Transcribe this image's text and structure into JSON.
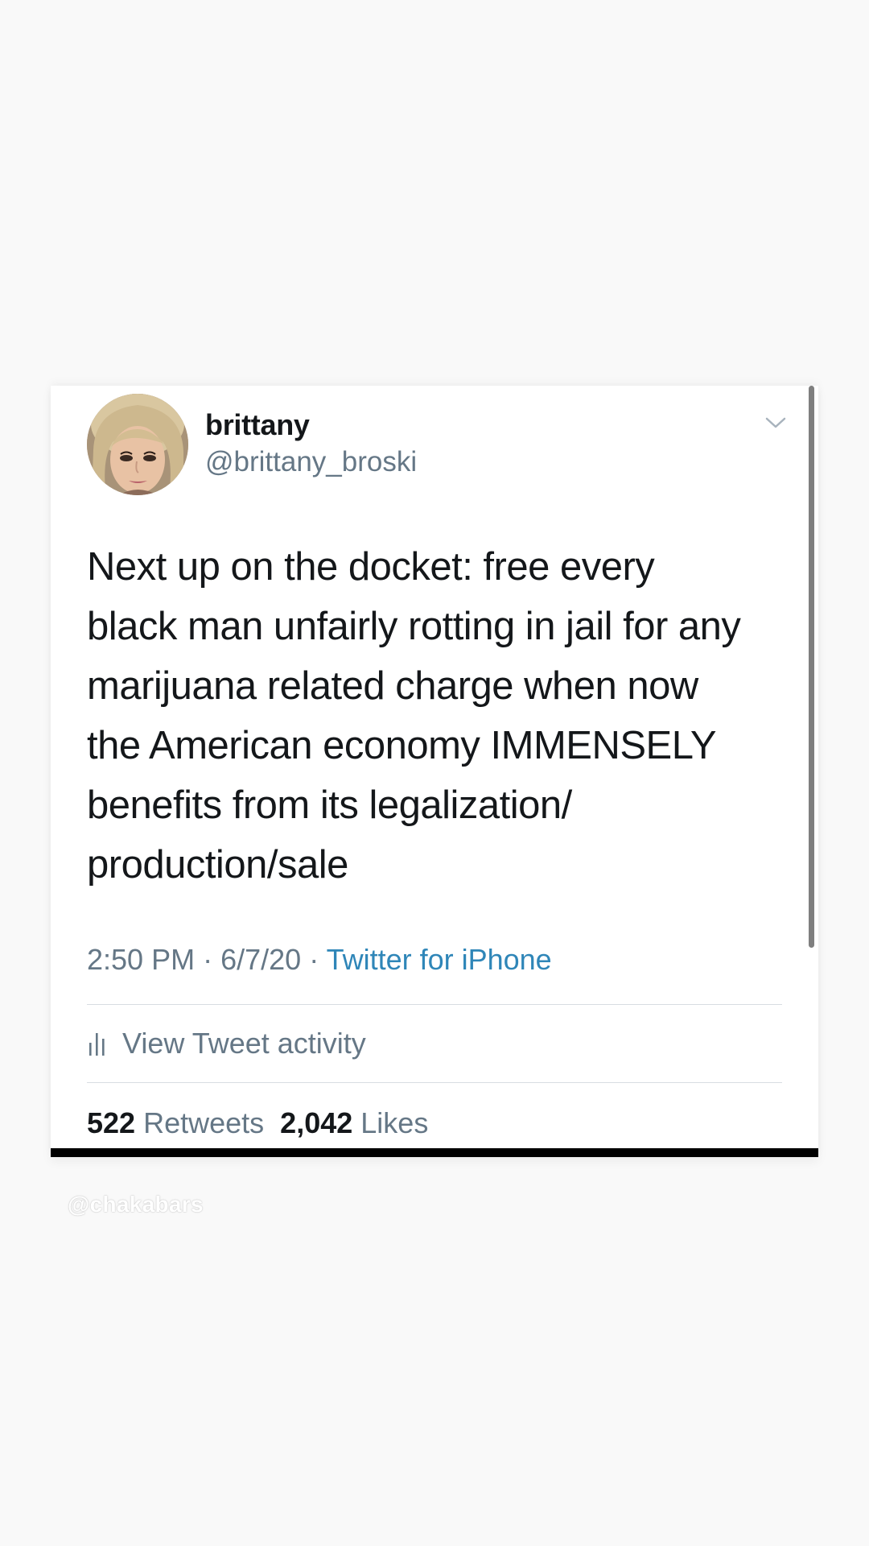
{
  "tweet": {
    "display_name": "brittany",
    "handle": "@brittany_broski",
    "text": "Next up on the docket: free every\nblack man unfairly rotting in jail for any\nmarijuana related charge when now\nthe American economy IMMENSELY\nbenefits from its legalization/\nproduction/sale",
    "time": "2:50 PM",
    "separator": "·",
    "date": "6/7/20",
    "source": "Twitter for iPhone",
    "activity_label": "View Tweet activity",
    "retweets_count": "522",
    "retweets_label": "Retweets",
    "likes_count": "2,042",
    "likes_label": "Likes"
  },
  "watermark": "@chakabars",
  "icons": {
    "avatar": "profile-photo",
    "menu": "chevron-down-icon",
    "activity": "bar-chart-icon"
  },
  "colors": {
    "background": "#f9f9f9",
    "card": "#ffffff",
    "primary_text": "#14171a",
    "secondary_text": "#657786",
    "link": "#2f86b8",
    "divider": "#d8dde2",
    "bottom_bar": "#000000"
  }
}
